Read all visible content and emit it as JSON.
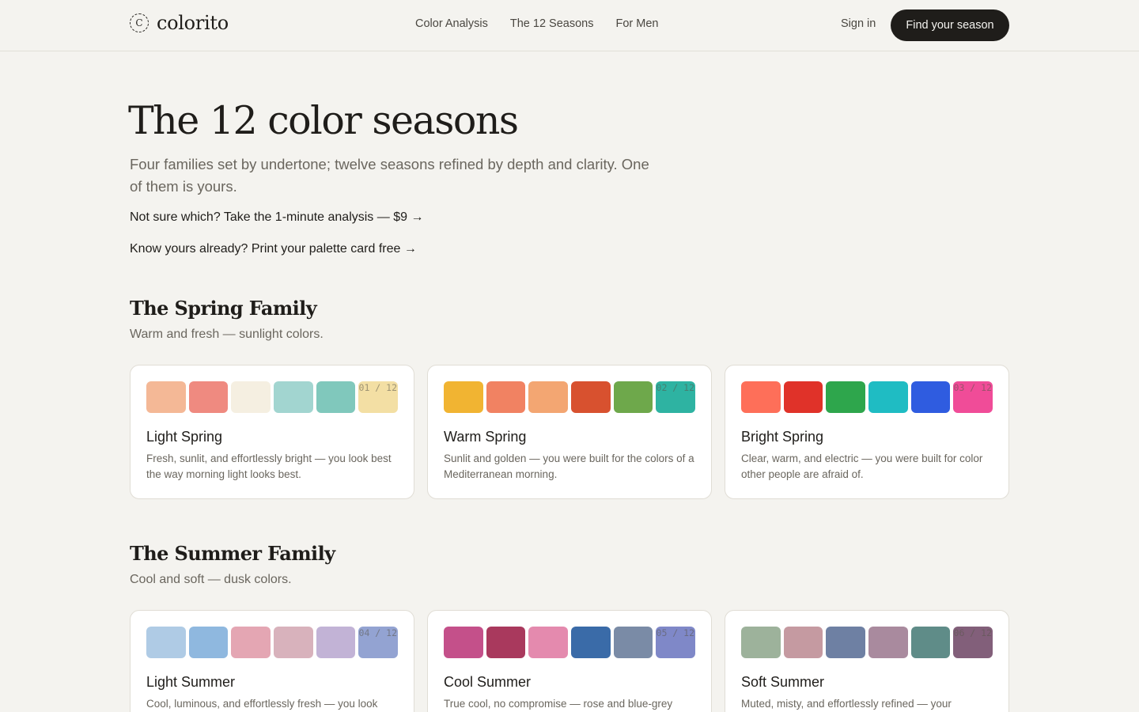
{
  "header": {
    "logo_mark": "C",
    "logo_text": "colorito",
    "nav": [
      "Color Analysis",
      "The 12 Seasons",
      "For Men"
    ],
    "sign_in": "Sign in",
    "cta": "Find your season"
  },
  "hero": {
    "title": "The 12 color seasons",
    "subtitle": "Four families set by undertone; twelve seasons refined by depth and clarity. One of them is yours.",
    "link_analysis": "Not sure which? Take the 1-minute analysis — $9 →",
    "link_palette": "Know yours already? Print your palette card free →"
  },
  "families": [
    {
      "title": "The Spring Family",
      "subtitle": "Warm and fresh — sunlight colors.",
      "seasons": [
        {
          "name": "Light Spring",
          "counter": "01 / 12",
          "description": "Fresh, sunlit, and effortlessly bright — you look best the way morning light looks best.",
          "swatches": [
            "#f4b896",
            "#ef8a80",
            "#f5efe1",
            "#a2d5d0",
            "#80c8bc",
            "#f3dfa4"
          ]
        },
        {
          "name": "Warm Spring",
          "counter": "02 / 12",
          "description": "Sunlit and golden — you were built for the colors of a Mediterranean morning.",
          "swatches": [
            "#f1b432",
            "#f18262",
            "#f3a672",
            "#d8512f",
            "#6ea84b",
            "#2eb3a2"
          ]
        },
        {
          "name": "Bright Spring",
          "counter": "03 / 12",
          "description": "Clear, warm, and electric — you were built for color other people are afraid of.",
          "swatches": [
            "#fe6f59",
            "#e03229",
            "#2ea64c",
            "#1fbcc3",
            "#2f5ce0",
            "#f04c98"
          ]
        }
      ]
    },
    {
      "title": "The Summer Family",
      "subtitle": "Cool and soft — dusk colors.",
      "seasons": [
        {
          "name": "Light Summer",
          "counter": "04 / 12",
          "description": "Cool, luminous, and effortlessly fresh — you look",
          "swatches": [
            "#afcbe5",
            "#8fb8df",
            "#e4a6b3",
            "#d8b2bc",
            "#c2b3d6",
            "#93a3d2"
          ]
        },
        {
          "name": "Cool Summer",
          "counter": "05 / 12",
          "description": "True cool, no compromise — rose and blue-grey",
          "swatches": [
            "#c4508a",
            "#a9395d",
            "#e48aae",
            "#3a6ba8",
            "#7a8ba6",
            "#7f88c8"
          ]
        },
        {
          "name": "Soft Summer",
          "counter": "06 / 12",
          "description": "Muted, misty, and effortlessly refined — your",
          "swatches": [
            "#9db29b",
            "#c59aa1",
            "#6e80a3",
            "#a98a9e",
            "#5f8c88",
            "#825f7a"
          ]
        }
      ]
    }
  ]
}
